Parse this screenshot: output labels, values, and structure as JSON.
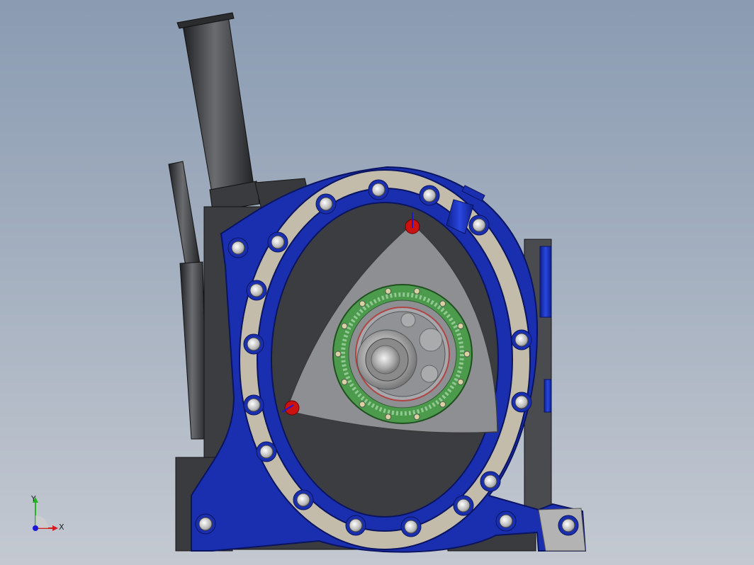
{
  "view": {
    "model": "rotary-engine-assembly",
    "colors": {
      "background_top": "#8a9bb2",
      "background_bottom": "#c4c9d1",
      "housing_blue": "#1a2fb0",
      "dark_block": "#3c3d40",
      "rotor_gray": "#8d8f92",
      "gear_green": "#4c9a4c",
      "seal_beige": "#c3bcaa",
      "apex_seal_red": "#cc1111"
    }
  },
  "triad": {
    "x_label": "X",
    "y_label": "Y",
    "x_color": "#d41e1e",
    "y_color": "#21b521",
    "z_color": "#1a1ad4"
  }
}
